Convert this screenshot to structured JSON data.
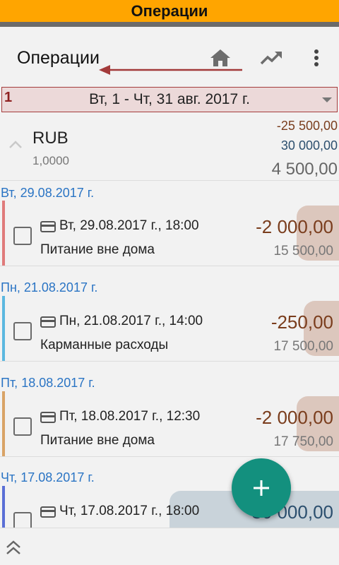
{
  "banner": {
    "title": "Операции"
  },
  "appbar": {
    "title": "Операции",
    "icons": [
      "home-icon",
      "trending-up-icon",
      "more-vertical-icon"
    ]
  },
  "period": {
    "number": "1",
    "label": "Вт, 1 - Чт, 31 авг. 2017 г."
  },
  "summary": {
    "currency": "RUB",
    "rate": "1,0000",
    "expense": "-25 500,00",
    "income": "30 000,00",
    "total": "4 500,00"
  },
  "groups": [
    {
      "header": "Вт, 29.08.2017 г.",
      "tx": {
        "datetime": "Вт, 29.08.2017 г., 18:00",
        "category": "Питание вне дома",
        "amount": "-2 000,00",
        "balance": "15 500,00",
        "color": "#e07b7b"
      }
    },
    {
      "header": "Пн, 21.08.2017 г.",
      "tx": {
        "datetime": "Пн, 21.08.2017 г., 14:00",
        "category": "Карманные расходы",
        "amount": "-250,00",
        "balance": "17 500,00",
        "color": "#5bb8e0"
      }
    },
    {
      "header": "Пт, 18.08.2017 г.",
      "tx": {
        "datetime": "Пт, 18.08.2017 г., 12:30",
        "category": "Питание вне дома",
        "amount": "-2 000,00",
        "balance": "17 750,00",
        "color": "#d9a366"
      }
    },
    {
      "header": "Чт, 17.08.2017 г.",
      "tx": {
        "datetime": "Чт, 17.08.2017 г., 18:00",
        "category": "",
        "amount": "30 000,00",
        "balance": "",
        "color": "#5a6fd6"
      }
    }
  ],
  "colors": {
    "banner": "#ffa500",
    "expense": "#7a3d1d",
    "income": "#2c4f6e",
    "date_header": "#2a74c4",
    "fab": "#13907e"
  }
}
